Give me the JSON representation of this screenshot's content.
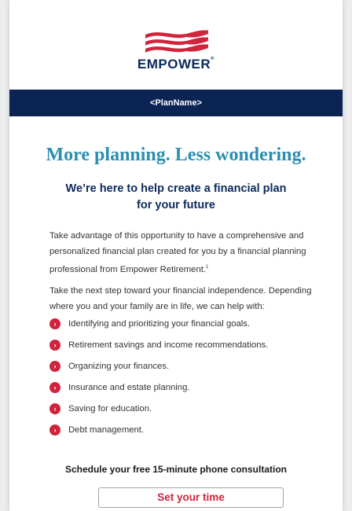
{
  "logo": {
    "brand": "EMPOWER",
    "registered": "®"
  },
  "banner": {
    "text": "<PlanName>"
  },
  "headline": "More planning. Less wondering.",
  "subhead": "We’re here to help create a financial plan for your future",
  "intro": {
    "text": "Take advantage of this opportunity to have a comprehensive and personalized financial plan created for you by a financial planning professional from Empower Retirement.",
    "footnote": "1"
  },
  "next_step": "Take the next step toward your financial independence. Depending where you and your family are in life, we can help with:",
  "list": {
    "items": [
      "Identifying and prioritizing your financial goals.",
      "Retirement savings and income recommendations.",
      "Organizing your finances.",
      "Insurance and estate planning.",
      "Saving for education.",
      "Debt management."
    ],
    "bullet_icon": "chevron-right-circle-icon",
    "bullet_color": "#d0233c"
  },
  "cta": {
    "text": "Schedule your free 15-minute phone consultation",
    "button_label": "Set your time"
  },
  "colors": {
    "navy": "#0b2454",
    "accent_red": "#d0233c",
    "headline_blue": "#2b8fb0"
  }
}
